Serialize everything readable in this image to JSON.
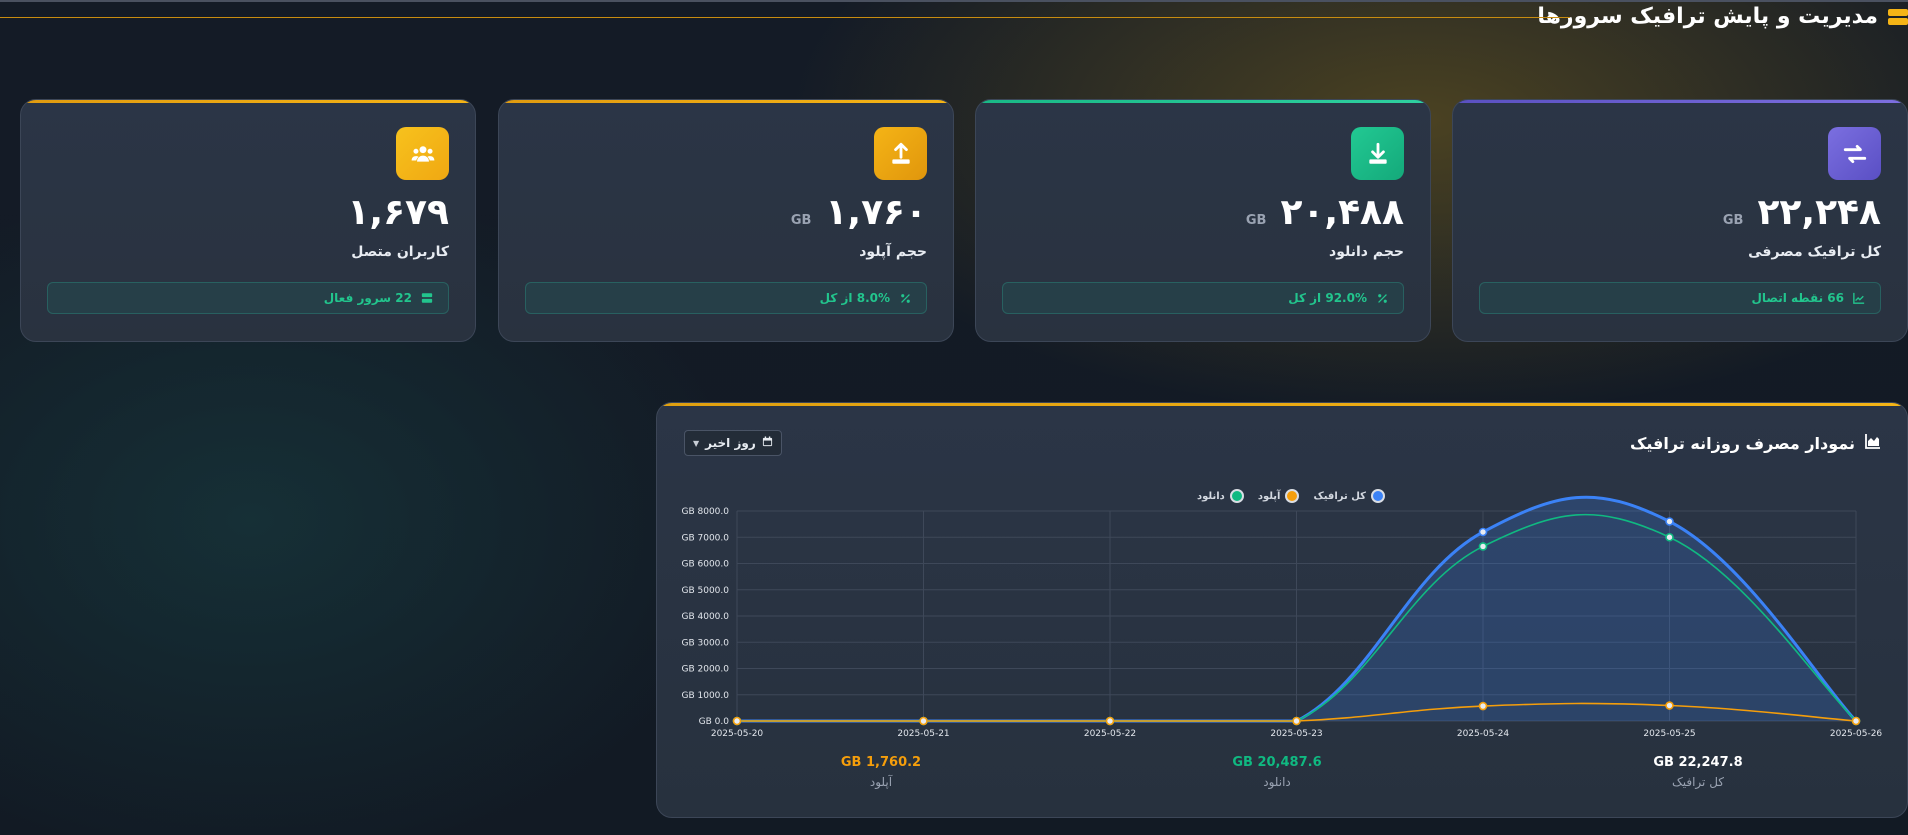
{
  "header": {
    "title": "مدیریت و پایش ترافیک سرورها",
    "icon": "server-icon",
    "accent": "#f5b416"
  },
  "cards": [
    {
      "id": "total",
      "value": "۲۲,۲۴۸",
      "unit": "GB",
      "label": "کل ترافیک مصرفی",
      "footer": "66 نقطه اتصال",
      "icon": "exchange-icon",
      "footer_icon": "chart-line-icon",
      "color": "#6a5fd0",
      "bar_color": "#7064d8"
    },
    {
      "id": "download",
      "value": "۲۰,۴۸۸",
      "unit": "GB",
      "label": "حجم دانلود",
      "footer": "92.0% از کل",
      "icon": "download-icon",
      "footer_icon": "percent-icon",
      "color": "#19b886",
      "bar_color": "#1fbf8d"
    },
    {
      "id": "upload",
      "value": "۱,۷۶۰",
      "unit": "GB",
      "label": "حجم آپلود",
      "footer": "8.0% از کل",
      "icon": "upload-icon",
      "footer_icon": "percent-icon",
      "color": "#f0a812",
      "bar_color": "#f0a812"
    },
    {
      "id": "users",
      "value": "۱,۶۷۹",
      "unit": "",
      "label": "کاربران متصل",
      "footer": "22 سرور فعال",
      "icon": "users-icon",
      "footer_icon": "server-icon",
      "color": "#f5b416",
      "bar_color": "#f0a812"
    }
  ],
  "chart_panel": {
    "title": "نمودار مصرف روزانه ترافیک",
    "title_icon": "area-chart-icon",
    "range_label": "روز اخیر",
    "range_icon": "calendar-icon"
  },
  "chart_data": {
    "type": "area",
    "categories": [
      "2025-05-20",
      "2025-05-21",
      "2025-05-22",
      "2025-05-23",
      "2025-05-24",
      "2025-05-25",
      "2025-05-26"
    ],
    "series": [
      {
        "name": "کل ترافیک",
        "color": "#3b82f6",
        "values": [
          0,
          0,
          0,
          0,
          7200,
          7600,
          0
        ]
      },
      {
        "name": "آپلود",
        "color": "#f59e0b",
        "values": [
          0,
          0,
          0,
          0,
          570,
          590,
          0
        ]
      },
      {
        "name": "دانلود",
        "color": "#10b981",
        "values": [
          0,
          0,
          0,
          0,
          6650,
          7000,
          0
        ]
      }
    ],
    "y_ticks": [
      "GB 0.0",
      "GB 1000.0",
      "GB 2000.0",
      "GB 3000.0",
      "GB 4000.0",
      "GB 5000.0",
      "GB 6000.0",
      "GB 7000.0",
      "GB 8000.0"
    ],
    "ylim": [
      0,
      8000
    ],
    "grid": true,
    "legend_position": "top-center"
  },
  "summary": [
    {
      "value": "GB 22,247.8",
      "label": "کل ترافیک",
      "color": "#ffffff"
    },
    {
      "value": "GB 20,487.6",
      "label": "دانلود",
      "color": "#10b981"
    },
    {
      "value": "GB 1,760.2",
      "label": "آپلود",
      "color": "#f59e0b"
    }
  ]
}
